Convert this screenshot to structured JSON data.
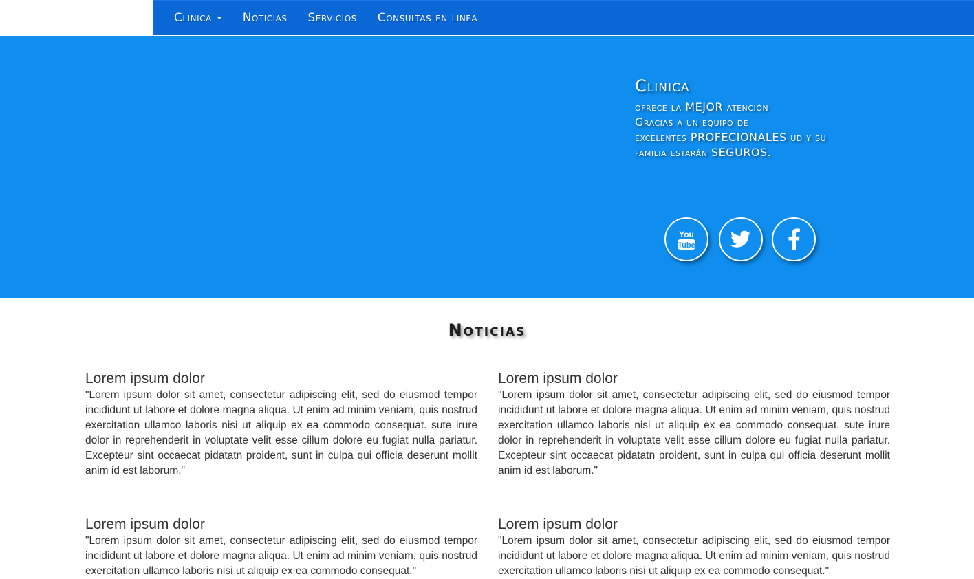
{
  "nav": {
    "items": [
      {
        "label": "Clinica",
        "dropdown": true
      },
      {
        "label": "Noticias"
      },
      {
        "label": "Servicios"
      },
      {
        "label": "Consultas en linea"
      }
    ]
  },
  "hero": {
    "title": "Clinica",
    "lines": [
      "ofrece la MEJOR atención",
      "Gracias a un equipo de",
      "excelentes PROFECIONALES ud y su",
      "familia estarán SEGUROS."
    ],
    "social": [
      {
        "icon": "youtube-icon"
      },
      {
        "icon": "twitter-icon"
      },
      {
        "icon": "facebook-icon"
      }
    ]
  },
  "news": {
    "title": "Noticias",
    "cards": [
      {
        "title": "Lorem ipsum dolor",
        "body": "\"Lorem ipsum dolor sit amet, consectetur adipiscing elit, sed do eiusmod tempor incididunt ut labore et dolore magna aliqua. Ut enim ad minim veniam, quis nostrud exercitation ullamco laboris nisi ut aliquip ex ea commodo consequat. sute irure dolor in reprehenderit in voluptate velit esse cillum dolore eu fugiat nulla pariatur. Excepteur sint occaecat pidatatn proident, sunt in culpa qui officia deserunt mollit anim id est laborum.\""
      },
      {
        "title": "Lorem ipsum dolor",
        "body": "\"Lorem ipsum dolor sit amet, consectetur adipiscing elit, sed do eiusmod tempor incididunt ut labore et dolore magna aliqua. Ut enim ad minim veniam, quis nostrud exercitation ullamco laboris nisi ut aliquip ex ea commodo consequat. sute irure dolor in reprehenderit in voluptate velit esse cillum dolore eu fugiat nulla pariatur. Excepteur sint occaecat pidatatn proident, sunt in culpa qui officia deserunt mollit anim id est laborum.\""
      },
      {
        "title": "Lorem ipsum dolor",
        "body": "\"Lorem ipsum dolor sit amet, consectetur adipiscing elit, sed do eiusmod tempor incididunt ut labore et dolore magna aliqua. Ut enim ad minim veniam, quis nostrud exercitation ullamco laboris nisi ut aliquip ex ea commodo consequat.\""
      },
      {
        "title": "Lorem ipsum dolor",
        "body": "\"Lorem ipsum dolor sit amet, consectetur adipiscing elit, sed do eiusmod tempor incididunt ut labore et dolore magna aliqua. Ut enim ad minim veniam, quis nostrud exercitation ullamco laboris nisi ut aliquip ex ea commodo consequat.\""
      }
    ]
  },
  "colors": {
    "nav_bg": "#0a67d6",
    "hero_bg": "#0f8eef"
  }
}
